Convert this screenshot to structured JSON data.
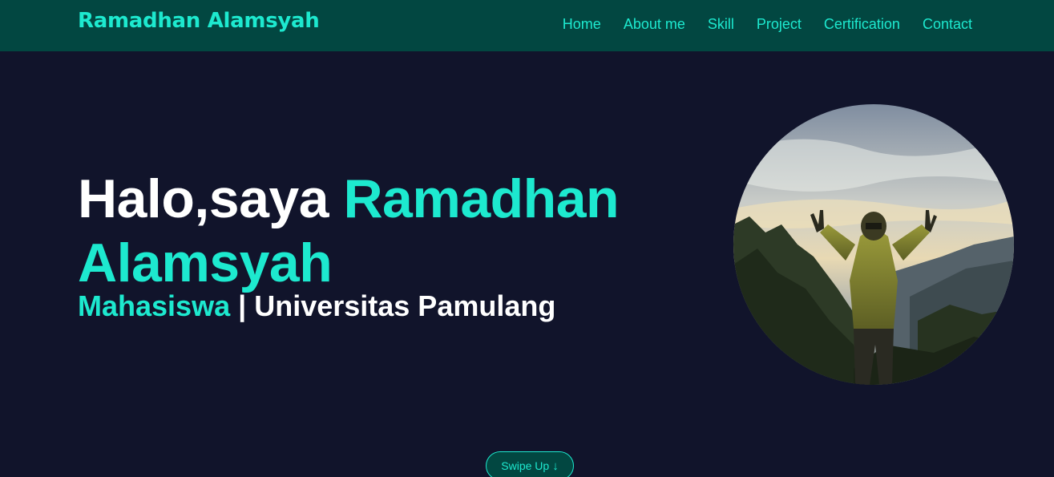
{
  "nav": {
    "brand": "Ramadhan Alamsyah",
    "links": [
      "Home",
      "About me",
      "Skill",
      "Project",
      "Certification",
      "Contact"
    ]
  },
  "hero": {
    "greeting": "Halo,saya",
    "name": "Ramadhan Alamsyah",
    "role": "Mahasiswa",
    "separator": "|",
    "institution": "Universitas Pamulang"
  },
  "swipe": {
    "label": "Swipe Up",
    "icon": "arrow-down-icon"
  },
  "colors": {
    "accent": "#1de9cf",
    "nav_bg": "#024741",
    "page_bg": "#11142b",
    "text": "#ffffff"
  }
}
